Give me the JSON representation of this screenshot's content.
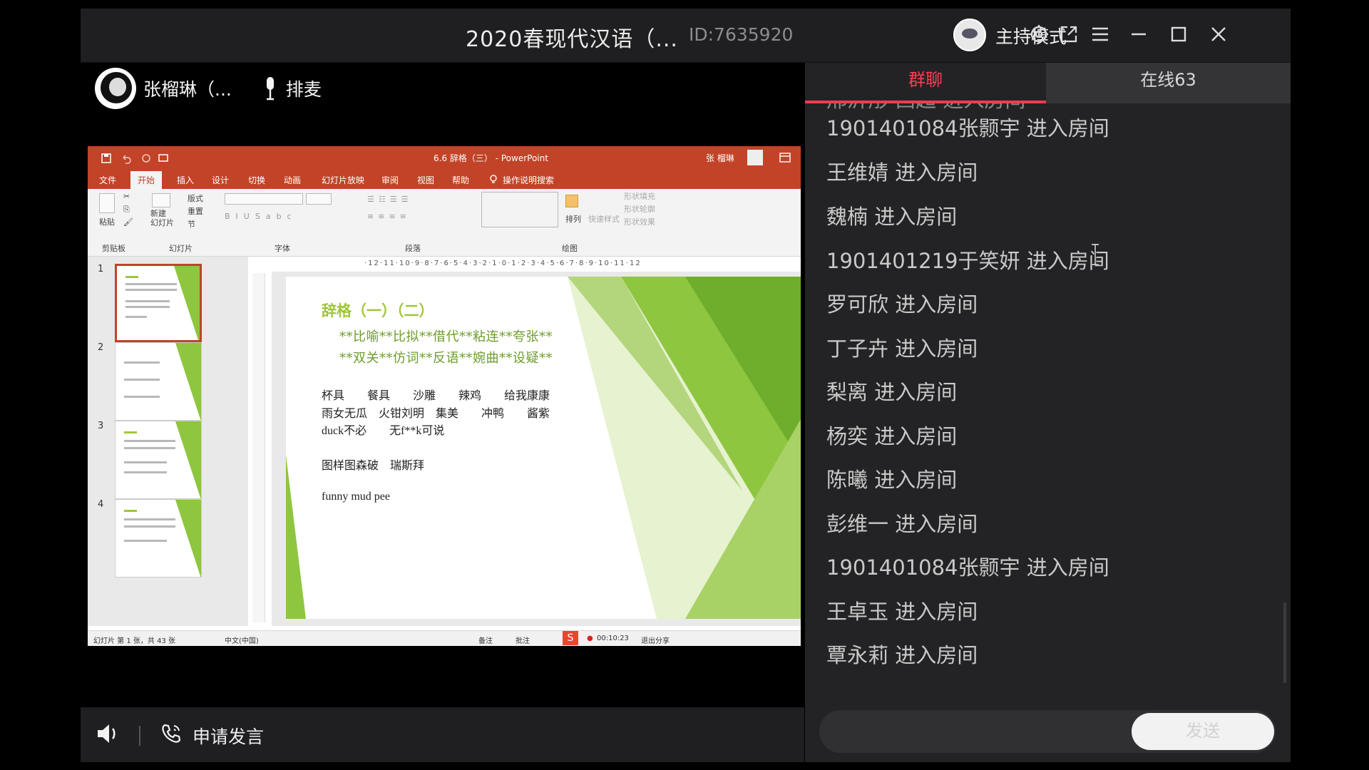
{
  "window": {
    "title": "2020春现代汉语（...",
    "room_id": "ID:7635920",
    "host_mode_label": "主持模式"
  },
  "presenter": {
    "name": "张榴琳（...",
    "queue_label": "排麦"
  },
  "powerpoint": {
    "doc_title": "6.6 辞格（三） - PowerPoint",
    "user": "张 榴琳",
    "tabs": [
      "文件",
      "开始",
      "插入",
      "设计",
      "切换",
      "动画",
      "幻灯片放映",
      "审阅",
      "视图",
      "帮助",
      "操作说明搜索"
    ],
    "groups": [
      "剪贴板",
      "幻灯片",
      "字体",
      "段落",
      "绘图"
    ],
    "ribbon_items": {
      "paste": "粘贴",
      "new_slide": "新建\n幻灯片",
      "layout": "版式",
      "reset": "重置",
      "section": "节",
      "arrange": "排列",
      "quick_styles": "快速样式",
      "shape_fill": "形状填充",
      "shape_outline": "形状轮廓",
      "shape_effects": "形状效果"
    },
    "ruler": "·12·11·10·9·8·7·6·5·4·3·2·1·0·1·2·3·4·5·6·7·8·9·10·11·12",
    "thumb_numbers": [
      "1",
      "2",
      "3",
      "4"
    ],
    "slide": {
      "title": "辞格（一）（二）",
      "line1": "**比喻**比拟**借代**粘连**夸张**",
      "line2": "**双关**仿词**反语**婉曲**设疑**",
      "row1": "杯具　　餐具　　沙雕　　辣鸡　　给我康康",
      "row2": "雨女无瓜　火钳刘明　集美　　冲鸭　　酱紫",
      "row3": "duck不必　　无f**k可说",
      "row4": "图样图森破　瑞斯拜",
      "row5": "funny mud pee"
    },
    "status": {
      "slide_count": "幻灯片 第 1 张，共 43 张",
      "language": "中文(中国)",
      "notes": "备注",
      "comments": "批注",
      "timer": "00:10:23",
      "exit_share": "退出分享"
    }
  },
  "bottom_bar": {
    "apply_label": "申请发言"
  },
  "chat": {
    "tab_chat": "群聊",
    "tab_online": "在线63",
    "cut_message": "邢沂彤 西超 进入房间",
    "messages": [
      "1901401084张颢宇 进入房间",
      "王维婧 进入房间",
      "魏楠 进入房间",
      "1901401219于笑妍 进入房间",
      "罗可欣 进入房间",
      "丁子卉 进入房间",
      "梨离 进入房间",
      "杨奕 进入房间",
      "陈曦 进入房间",
      "彭维一 进入房间",
      "1901401084张颢宇 进入房间",
      "王卓玉 进入房间",
      "覃永莉 进入房间"
    ],
    "input_placeholder": "",
    "send_label": "发送"
  },
  "colors": {
    "accent": "#ff3b52",
    "ppt_red": "#c24328",
    "slide_green": "#8ec63f"
  }
}
